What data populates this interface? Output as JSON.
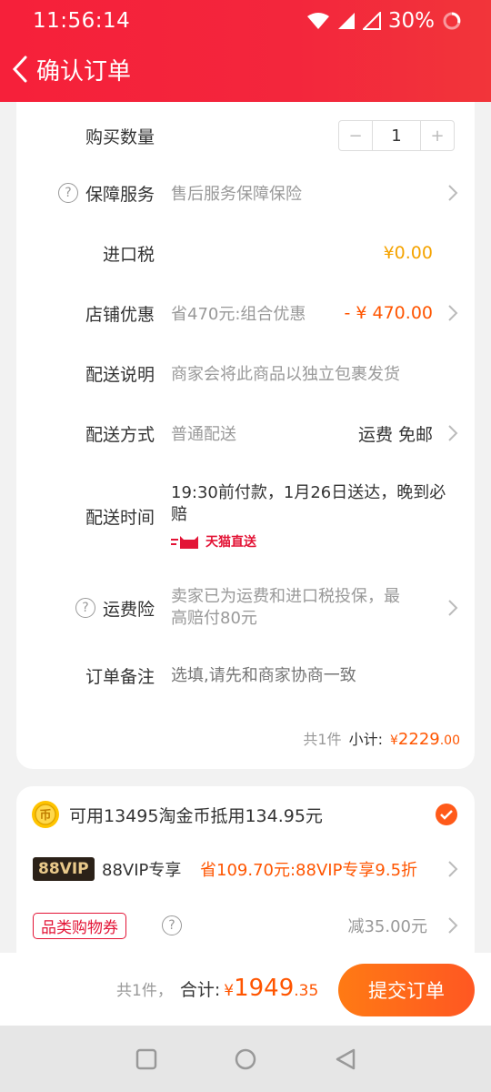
{
  "status": {
    "time": "11:56:14",
    "battery": "30%"
  },
  "header": {
    "title": "确认订单"
  },
  "order": {
    "quantity_label": "购买数量",
    "quantity_value": "1",
    "quantity_minus": "−",
    "quantity_plus": "+",
    "service_label": "保障服务",
    "service_value": "售后服务保障保险",
    "tax_label": "进口税",
    "tax_value": "¥0.00",
    "discount_label": "店铺优惠",
    "discount_value": "省470元:组合优惠",
    "discount_amount": "- ¥ 470.00",
    "delivery_note_label": "配送说明",
    "delivery_note_value": "商家会将此商品以独立包裹发货",
    "shipping_method_label": "配送方式",
    "shipping_method_value": "普通配送",
    "shipping_fee": "运费 免邮",
    "delivery_time_label": "配送时间",
    "delivery_time_line1": "19:30前付款，1月26日送达，晚到必",
    "delivery_time_line2": "赔",
    "tmall_badge": "天猫直送",
    "insurance_label": "运费险",
    "insurance_line1": "卖家已为运费和进口税投保，最",
    "insurance_line2": "高赔付80元",
    "remark_label": "订单备注",
    "remark_placeholder": "选填,请先和商家协商一致",
    "summary_count": "共1件",
    "summary_label": "小计:",
    "summary_currency": "¥",
    "summary_int": "2229",
    "summary_dec": ".00"
  },
  "benefits": {
    "coins_text": "可用13495淘金币抵用134.95元",
    "vip_badge": "88VIP",
    "vip_label": "88VIP专享",
    "vip_value": "省109.70元:88VIP专享9.5折",
    "coupon_badge": "品类购物券",
    "coupon_value": "减35.00元"
  },
  "footer": {
    "count": "共1件，",
    "total_label": "合计:",
    "currency": "¥",
    "total_int": "1949",
    "total_dec": ".35",
    "submit": "提交订单"
  },
  "colors": {
    "brand_red": "#f3263c",
    "orange": "#ff5500",
    "submit_orange": "#ff6a1a",
    "tax_yellow": "#f5a300"
  }
}
